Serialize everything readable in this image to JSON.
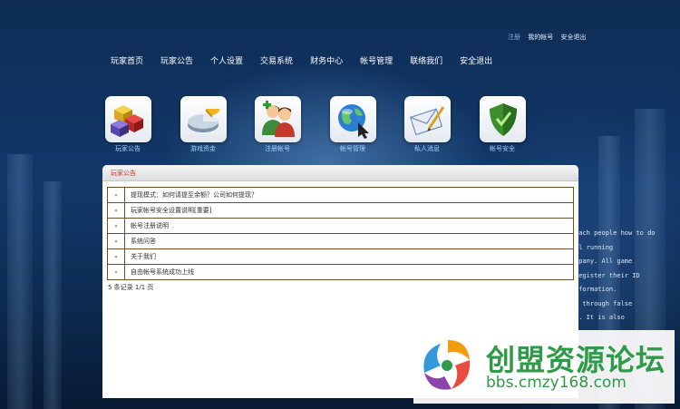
{
  "top_links": {
    "faint": "注册",
    "account": "我的帐号",
    "logout": "安全退出"
  },
  "nav": [
    "玩家首页",
    "玩家公告",
    "个人设置",
    "交易系统",
    "财务中心",
    "帐号管理",
    "联络我们",
    "安全退出"
  ],
  "icons": [
    {
      "label": "玩家公告",
      "icon": "cubes-icon"
    },
    {
      "label": "游戏资金",
      "icon": "pie-chart-icon"
    },
    {
      "label": "注册帐号",
      "icon": "users-icon"
    },
    {
      "label": "帐号管理",
      "icon": "globe-icon"
    },
    {
      "label": "私人消息",
      "icon": "mail-icon"
    },
    {
      "label": "帐号安全",
      "icon": "shield-icon"
    }
  ],
  "panel": {
    "title": "玩家公告",
    "marker": "»",
    "rows": [
      "提现模式：如何请提至余额？公司如何提现？",
      "玩家帐号安全设置说明[重要]",
      "帐号注册说明",
      "系统问答",
      "关于我们",
      "自由帐号系统成功上线"
    ],
    "pager": "5 条记录 1/1 页"
  },
  "background_text": [
    "each people how to do",
    "al running",
    "mpany. All game",
    "register their ID",
    "nformation.",
    "e through false",
    "l. It is also"
  ],
  "watermark": {
    "title": "创盟资源论坛",
    "url": "bbs.cmzy168.com"
  },
  "colors": {
    "nav_text": "#ffffff",
    "icon_label": "#9fd4ff",
    "panel_title": "#c0392b",
    "row_border": "#6b4f2a",
    "watermark_green": "#2f9a48"
  }
}
